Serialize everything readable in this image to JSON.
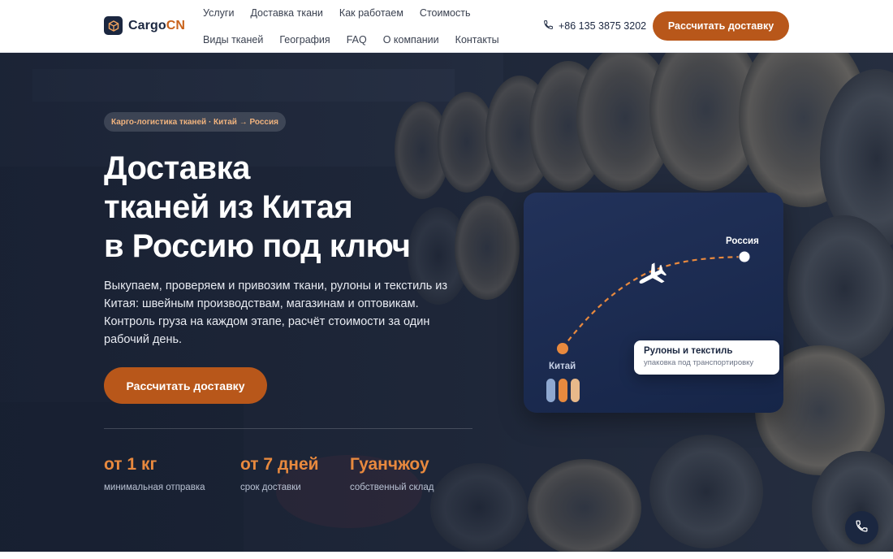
{
  "brand": {
    "name_main": "Cargo",
    "name_accent": "CN",
    "accent_color": "#b8571a",
    "dark_color": "#1b2740"
  },
  "nav": {
    "row1": [
      "Услуги",
      "Доставка ткани",
      "Как работаем",
      "Стоимость"
    ],
    "row2": [
      "Виды тканей",
      "География",
      "FAQ",
      "О компании",
      "Контакты"
    ]
  },
  "header": {
    "phone": "+86 135 3875 3202",
    "phone_icon": "phone-icon",
    "cta_label": "Рассчитать доставку"
  },
  "hero": {
    "badge": "Карго-логистика тканей · Китай → Россия",
    "title_lines": [
      "Доставка",
      "тканей из Китая",
      "в Россию под ключ"
    ],
    "description": "Выкупаем, проверяем и привозим ткани, рулоны и текстиль из Китая: швейным производствам, магазинам и оптовикам. Контроль груза на каждом этапе, расчёт стоимости за один рабочий день.",
    "cta_label": "Рассчитать доставку",
    "stats": [
      {
        "value": "от 1 кг",
        "label": "минимальная отправка"
      },
      {
        "value": "от 7 дней",
        "label": "срок доставки"
      },
      {
        "value": "Гуанчжоу",
        "label": "собственный склад"
      }
    ]
  },
  "map_card": {
    "destination": "Россия",
    "origin": "Китай",
    "plane_icon": "airplane-icon",
    "bar_colors": [
      "#8fa8d0",
      "#e8893e",
      "#e8b98a"
    ],
    "info_title": "Рулоны и текстиль",
    "info_subtitle": "упаковка под транспортировку"
  },
  "floating": {
    "icon": "phone-icon"
  }
}
